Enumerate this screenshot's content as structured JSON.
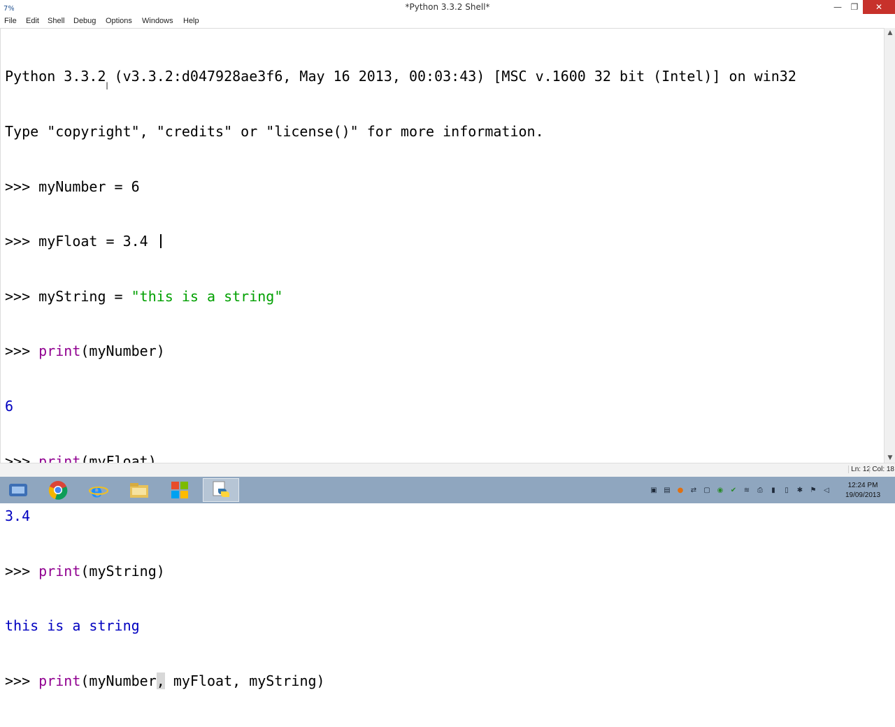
{
  "window": {
    "title": "*Python 3.3.2 Shell*",
    "app_icon_label": "7%",
    "minimize_glyph": "—",
    "maximize_glyph": "❐",
    "close_glyph": "✕"
  },
  "menu": {
    "items": [
      "File",
      "Edit",
      "Shell",
      "Debug",
      "Options",
      "Windows",
      "Help"
    ]
  },
  "shell": {
    "banner_1": "Python 3.3.2 (v3.3.2:d047928ae3f6, May 16 2013, 00:03:43) [MSC v.1600 32 bit (Intel)] on win32",
    "banner_2": "Type \"copyright\", \"credits\" or \"license()\" for more information.",
    "prompt": ">>> ",
    "lines": [
      {
        "code_plain": "myNumber = 6"
      },
      {
        "code_plain": "myFloat = 3.4"
      },
      {
        "code_pre": "myString = ",
        "code_str": "\"this is a string\""
      },
      {
        "code_kw": "print",
        "code_post": "(myNumber)"
      },
      {
        "output": "6"
      },
      {
        "code_kw": "print",
        "code_post": "(myFloat)"
      },
      {
        "output": "3.4"
      },
      {
        "code_kw": "print",
        "code_post": "(myString)"
      },
      {
        "output": "this is a string"
      }
    ],
    "current_line": {
      "code_kw": "print",
      "code_a": "(myNumber",
      "code_sel": ",",
      "code_b": " myFloat, myString)"
    }
  },
  "scrollbar": {
    "up_glyph": "▲",
    "down_glyph": "▼"
  },
  "status": {
    "line": "Ln: 12",
    "col": "Col: 18"
  },
  "taskbar": {
    "items": [
      "windows-explorer",
      "chrome",
      "internet-explorer",
      "file-explorer",
      "office",
      "python-idle"
    ],
    "clock_time": "12:24 PM",
    "clock_date": "19/09/2013"
  },
  "colors": {
    "keyword": "#900090",
    "string": "#00a000",
    "output": "#0000c0",
    "close_button": "#c7312b",
    "taskbar": "#8fa6bf"
  }
}
